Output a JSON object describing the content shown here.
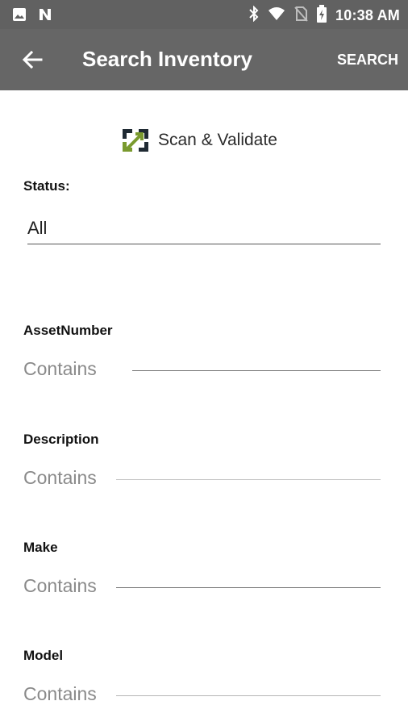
{
  "status_bar": {
    "time": "10:38 AM",
    "icons": [
      "image-icon",
      "notification-n-icon",
      "bluetooth-icon",
      "wifi-icon",
      "no-sim-icon",
      "battery-charging-icon"
    ]
  },
  "app_bar": {
    "title": "Search Inventory",
    "action_label": "SEARCH",
    "back_icon": "arrow-back-icon"
  },
  "logo": {
    "text": "Scan & Validate",
    "colors": {
      "dark": "#1f2a33",
      "accent": "#7a9a2e"
    }
  },
  "form": {
    "status": {
      "label": "Status:",
      "value": "All"
    },
    "fields": [
      {
        "label": "AssetNumber",
        "placeholder": "Contains"
      },
      {
        "label": "Description",
        "placeholder": "Contains"
      },
      {
        "label": "Make",
        "placeholder": "Contains"
      },
      {
        "label": "Model",
        "placeholder": "Contains"
      }
    ]
  },
  "colors": {
    "app_bar": "#666666",
    "status_bar": "#616161",
    "placeholder": "#8a8a8a"
  }
}
